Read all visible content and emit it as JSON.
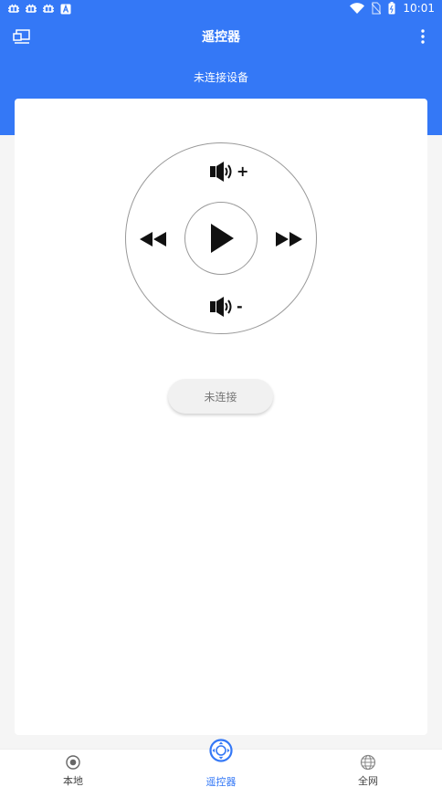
{
  "status_bar": {
    "time": "10:01",
    "notification_icons": [
      "bug-icon",
      "bug-icon",
      "bug-icon",
      "font-a-icon"
    ],
    "right_icons": [
      "wifi-icon",
      "no-sim-icon",
      "battery-icon"
    ]
  },
  "app_bar": {
    "title": "遥控器"
  },
  "connection_status": "未连接设备",
  "remote": {
    "vol_up_symbol": "+",
    "vol_down_symbol": "-"
  },
  "connect_button": {
    "label": "未连接"
  },
  "bottom_nav": {
    "items": [
      {
        "label": "本地",
        "icon": "radio-target-icon",
        "active": false
      },
      {
        "label": "遥控器",
        "icon": "remote-dpad-icon",
        "active": true
      },
      {
        "label": "全网",
        "icon": "globe-icon",
        "active": false
      }
    ]
  },
  "colors": {
    "primary": "#3478f6",
    "background": "#f5f5f5",
    "card": "#ffffff",
    "text_muted": "#777777"
  }
}
